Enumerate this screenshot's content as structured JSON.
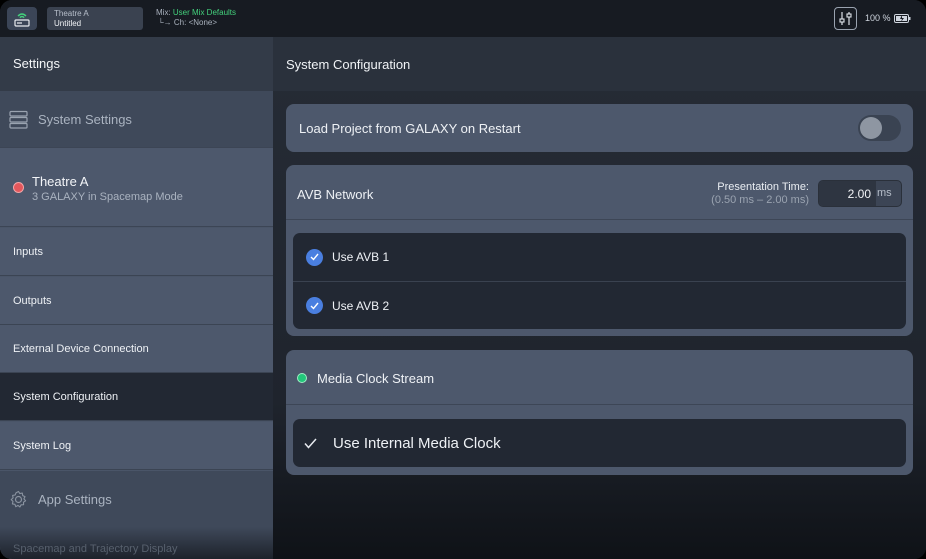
{
  "topbar": {
    "project_venue": "Theatre A",
    "project_name": "Untitled",
    "mix_prefix": "Mix:",
    "mix_value": "User Mix Defaults",
    "channel": "Ch: <None>",
    "battery_text": "100 %"
  },
  "sidebar": {
    "title": "Settings",
    "system_settings_label": "System Settings",
    "device": {
      "name": "Theatre A",
      "subtitle": "3 GALAXY in Spacemap Mode",
      "status_color": "#e4575c"
    },
    "items": [
      {
        "label": "Inputs"
      },
      {
        "label": "Outputs"
      },
      {
        "label": "External Device Connection"
      },
      {
        "label": "System Configuration"
      },
      {
        "label": "System Log"
      }
    ],
    "app_settings_label": "App Settings",
    "next_item": "Spacemap and Trajectory Display"
  },
  "main": {
    "title": "System Configuration",
    "load_project_label": "Load Project from GALAXY on Restart",
    "load_project_enabled": false,
    "avb": {
      "title": "AVB Network",
      "presentation_label": "Presentation Time:",
      "presentation_range": "(0.50 ms – 2.00 ms)",
      "presentation_value": "2.00",
      "presentation_unit": "ms",
      "options": [
        {
          "label": "Use AVB 1",
          "checked": true
        },
        {
          "label": "Use AVB 2",
          "checked": true
        }
      ]
    },
    "clock": {
      "title": "Media Clock Stream",
      "status_color": "#22c77a",
      "option_label": "Use Internal Media Clock",
      "option_checked": true
    }
  },
  "accent_color": "#4a7fe0"
}
